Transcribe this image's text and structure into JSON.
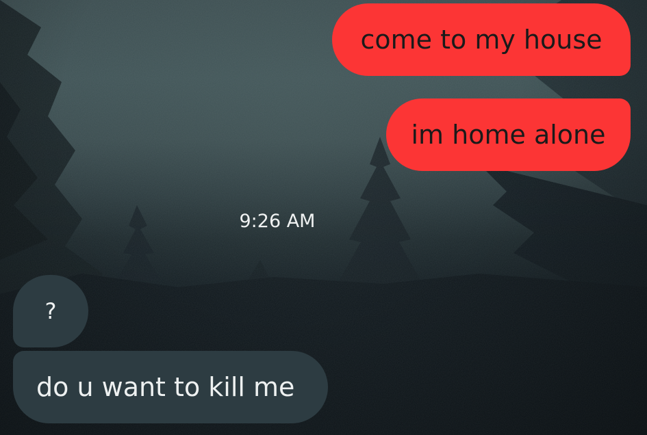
{
  "conversation": {
    "messages": [
      {
        "direction": "sent",
        "text": "come to my house"
      },
      {
        "direction": "sent",
        "text": "im home alone"
      },
      {
        "direction": "received",
        "text": "?"
      },
      {
        "direction": "received",
        "text": "do u want to kill me"
      }
    ],
    "timestamp": "9:26 AM"
  },
  "colors": {
    "sent_bubble": "#fc3535",
    "received_bubble": "#2d3c42",
    "background_sky": "#3b4d50",
    "background_ground": "#10181d"
  }
}
